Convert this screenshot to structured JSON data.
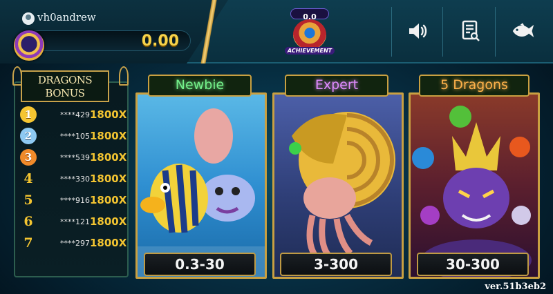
{
  "player": {
    "username": "vh0andrew",
    "balance": "0.00"
  },
  "achievement": {
    "value": "0.0",
    "label": "ACHIEVEMENT"
  },
  "toolbar": [
    {
      "name": "sound-button",
      "icon": "speaker-icon"
    },
    {
      "name": "history-button",
      "icon": "document-search-icon"
    },
    {
      "name": "fish-menu-button",
      "icon": "fish-icon"
    }
  ],
  "bonus": {
    "title_line1": "DRAGONS",
    "title_line2": "BONUS",
    "rows": [
      {
        "rank": "1",
        "player": "****429",
        "multiplier": "1800X"
      },
      {
        "rank": "2",
        "player": "****105",
        "multiplier": "1800X"
      },
      {
        "rank": "3",
        "player": "****539",
        "multiplier": "1800X"
      },
      {
        "rank": "4",
        "player": "****330",
        "multiplier": "1800X"
      },
      {
        "rank": "5",
        "player": "****916",
        "multiplier": "1800X"
      },
      {
        "rank": "6",
        "player": "****121",
        "multiplier": "1800X"
      },
      {
        "rank": "7",
        "player": "****297",
        "multiplier": "1800X"
      }
    ]
  },
  "rooms": [
    {
      "name": "Newbie",
      "range": "0.3-30",
      "label_color": "#74f08a"
    },
    {
      "name": "Expert",
      "range": "3-300",
      "label_color": "#e08bff"
    },
    {
      "name": "5 Dragons",
      "range": "30-300",
      "label_color": "#ffb24a"
    }
  ],
  "version": "ver.51b3eb2"
}
